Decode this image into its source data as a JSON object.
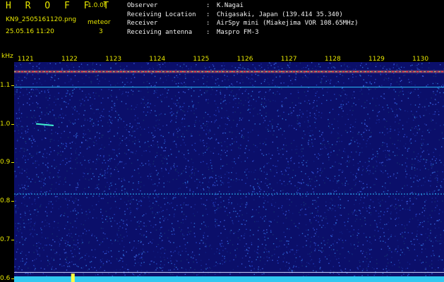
{
  "header": {
    "app_title": "H R O F F T",
    "version": "1.0.0f",
    "filename": "KN9_2505161120.png",
    "mode": "meteor",
    "count": "3",
    "datetime": "25.05.16 11:20"
  },
  "info": [
    {
      "key": "Observer",
      "sep": ":",
      "value": "K.Nagai"
    },
    {
      "key": "Receiving Location",
      "sep": ":",
      "value": "Chigasaki, Japan (139.414 35.340)"
    },
    {
      "key": "Receiver",
      "sep": ":",
      "value": "AirSpy mini (Miakejima VOR 108.65MHz)"
    },
    {
      "key": "Receiving antenna",
      "sep": ":",
      "value": "Maspro FM-3"
    }
  ],
  "chart_data": {
    "type": "heatmap",
    "ylabel": "kHz",
    "y_ticks": [
      "1.1",
      "1.0",
      "0.9",
      "0.8",
      "0.7",
      "0.6"
    ],
    "x_ticks": [
      "1121",
      "1122",
      "1123",
      "1124",
      "1125",
      "1126",
      "1127",
      "1128",
      "1129",
      "1130"
    ],
    "ylim": [
      0.59,
      1.16
    ],
    "xlim": [
      1120.6,
      1130.4
    ],
    "carrier_khz": 1.135,
    "horizontal_lines_khz": [
      1.095,
      0.818
    ],
    "meteor_echo": {
      "x_start": 1121.1,
      "x_end": 1121.5,
      "khz_start": 1.0,
      "khz_end": 0.99
    },
    "colors": {
      "background": "#0b0f6a",
      "carrier": "#ff4040",
      "lines": "#2ec8ff",
      "text": "#e6e600"
    }
  }
}
